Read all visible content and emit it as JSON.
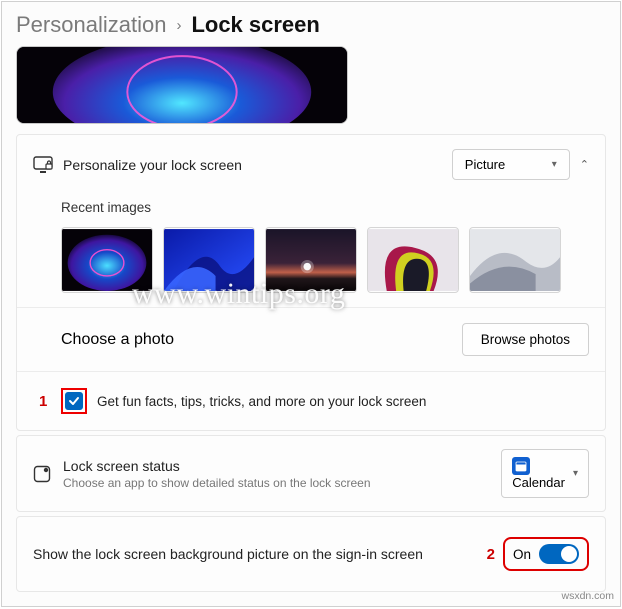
{
  "breadcrumb": {
    "parent": "Personalization",
    "sep": "›",
    "current": "Lock screen"
  },
  "personalize": {
    "label": "Personalize your lock screen",
    "dropdown_value": "Picture"
  },
  "recent": {
    "title": "Recent images"
  },
  "choose": {
    "label": "Choose a photo",
    "button": "Browse photos"
  },
  "funfacts": {
    "step": "1",
    "label": "Get fun facts, tips, tricks, and more on your lock screen",
    "checked": true
  },
  "status": {
    "title": "Lock screen status",
    "subtitle": "Choose an app to show detailed status on the lock screen",
    "app": "Calendar"
  },
  "signin": {
    "label": "Show the lock screen background picture on the sign-in screen",
    "step": "2",
    "state": "On"
  },
  "watermark": "www.wintips.org",
  "source": "wsxdn.com"
}
